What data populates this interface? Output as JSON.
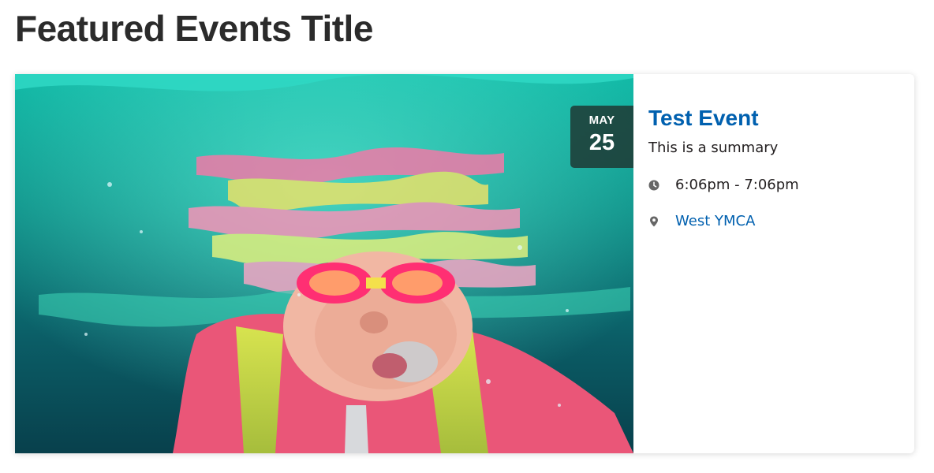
{
  "section": {
    "title": "Featured Events Title"
  },
  "event": {
    "image_alt": "child swimming underwater wearing pink goggles",
    "date": {
      "month": "MAY",
      "day": "25"
    },
    "title": "Test Event",
    "summary": "This is a summary",
    "time": "6:06pm - 7:06pm",
    "location": "West YMCA"
  },
  "icons": {
    "time": "clock-icon",
    "location": "map-pin-icon"
  },
  "colors": {
    "link": "#0060af",
    "heading": "#2b2b2b",
    "text": "#231f20",
    "badge_bg": "#1e3430",
    "icon": "#666666"
  }
}
